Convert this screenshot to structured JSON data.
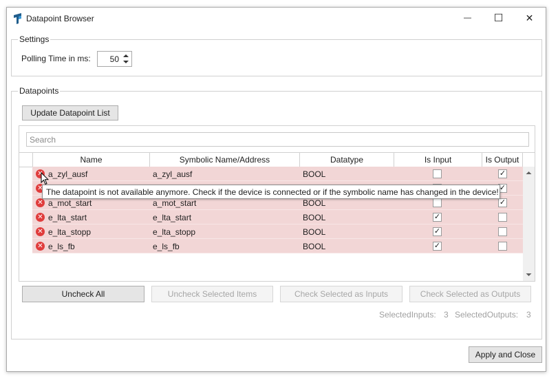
{
  "window": {
    "title": "Datapoint Browser",
    "minimize_glyph": "—",
    "maximize_glyph": "☐",
    "close_glyph": "✕"
  },
  "settings": {
    "group_label": "Settings",
    "polling_label": "Polling Time in ms:",
    "polling_value": "50"
  },
  "datapoints": {
    "group_label": "Datapoints",
    "update_button": "Update Datapoint List",
    "search_placeholder": "Search",
    "columns": {
      "name": "Name",
      "symbolic": "Symbolic Name/Address",
      "datatype": "Datatype",
      "is_input": "Is Input",
      "is_output": "Is Output"
    },
    "rows": [
      {
        "name": "a_zyl_ausf",
        "symbolic": "a_zyl_ausf",
        "datatype": "BOOL",
        "is_input": false,
        "is_output": true
      },
      {
        "name": "",
        "symbolic": "",
        "datatype": "",
        "is_input": false,
        "is_output": true
      },
      {
        "name": "a_mot_start",
        "symbolic": "a_mot_start",
        "datatype": "BOOL",
        "is_input": false,
        "is_output": true
      },
      {
        "name": "e_lta_start",
        "symbolic": "e_lta_start",
        "datatype": "BOOL",
        "is_input": true,
        "is_output": false
      },
      {
        "name": "e_lta_stopp",
        "symbolic": "e_lta_stopp",
        "datatype": "BOOL",
        "is_input": true,
        "is_output": false
      },
      {
        "name": "e_ls_fb",
        "symbolic": "e_ls_fb",
        "datatype": "BOOL",
        "is_input": true,
        "is_output": false
      }
    ],
    "tooltip": "The datapoint is not available anymore. Check if the device is connected or if the symbolic name has changed in the device!",
    "error_icon_glyph": "✕"
  },
  "actions": {
    "uncheck_all": "Uncheck All",
    "uncheck_selected": "Uncheck Selected Items",
    "check_inputs": "Check Selected as Inputs",
    "check_outputs": "Check Selected as Outputs"
  },
  "stats": {
    "selected_inputs_label": "SelectedInputs:",
    "selected_inputs_value": "3",
    "selected_outputs_label": "SelectedOutputs:",
    "selected_outputs_value": "3"
  },
  "footer": {
    "apply_close": "Apply and Close"
  },
  "colors": {
    "error_row": "#f2d6d6",
    "error_icon": "#e03c3c"
  }
}
